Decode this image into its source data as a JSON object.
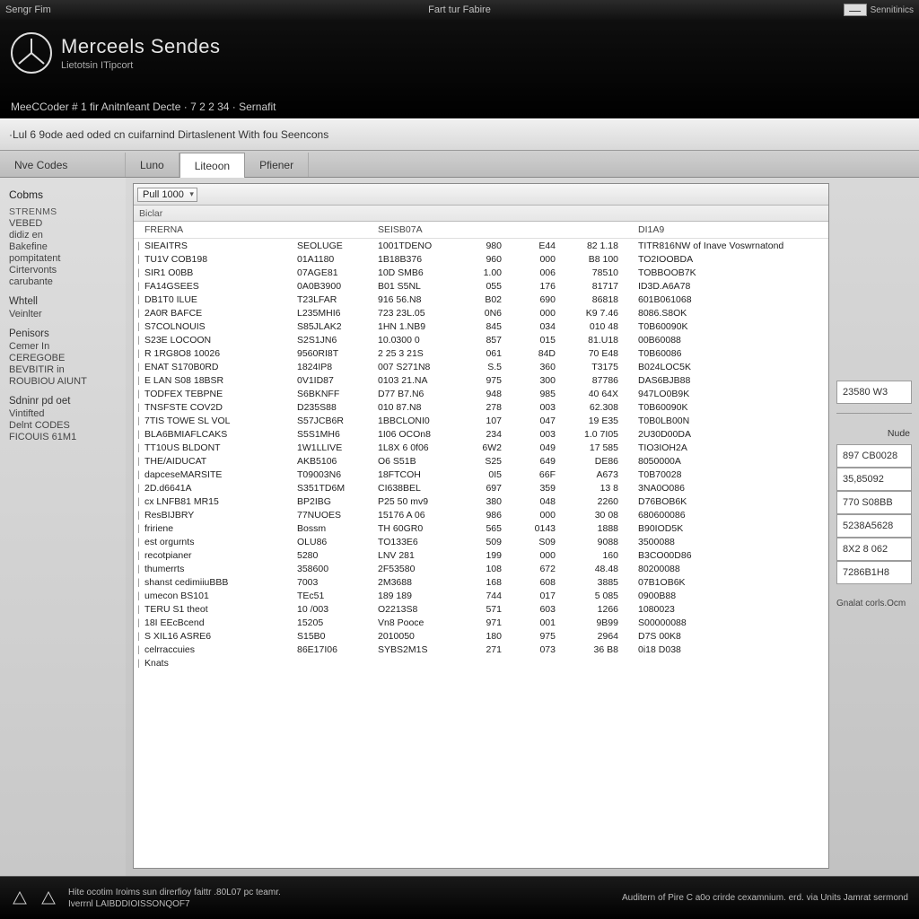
{
  "window": {
    "left_label": "Sengr Fim",
    "center_label": "Fart tur Fabire",
    "settings_label": "Sennitinics"
  },
  "brand": {
    "title": "Merceels Sendes",
    "subtitle": "Lietotsin ITipcort",
    "breadcrumb": "MeeCCoder # 1 fir Anitnfeant Decte · 7 2 2 34 · Sernafit"
  },
  "sub_header": "Lul 6 9ode aed oded cn cuifarnind Dirtaslenent With fou Seencons",
  "tabs": [
    {
      "label": "Nve Codes",
      "active": false
    },
    {
      "label": "Luno",
      "active": false
    },
    {
      "label": "Liteoon",
      "active": true
    },
    {
      "label": "Pfiener",
      "active": false
    }
  ],
  "sidebar": {
    "heading": "Cobms",
    "groups": [
      {
        "label": "STRENMS",
        "items": [
          "VEBED",
          "didiz en",
          "Bakefine",
          "pompitatent",
          "Cirtervonts",
          "carubante"
        ]
      },
      {
        "label": "Whtell",
        "items": [
          "Veinlter"
        ]
      },
      {
        "label": "Penisors",
        "items": [
          "Cemer In",
          "CEREGOBE",
          "BEVBITIR in",
          "ROUBIOU AIUNT"
        ]
      },
      {
        "label": "Sdninr pd oet",
        "items": [
          "Vintifted",
          "Delnt CODES",
          "FICOUIS 61M1"
        ]
      }
    ]
  },
  "toolbar": {
    "combo_label": "Pull 1000",
    "filter_label": "Biclar"
  },
  "columns": [
    "FRERNA",
    "",
    "SEISB07A",
    "",
    "",
    "",
    "DI1A9"
  ],
  "rows": [
    [
      "SIEAITRS",
      "SEOLUGE",
      "1001TDENO",
      "980",
      "E44",
      "82 1.18",
      "TITR816NW of Inave  Voswrnatond"
    ],
    [
      "TU1V COB198",
      "01A1180",
      "1B18B376",
      "960",
      "000",
      "B8 100",
      "TO2IOOBDA"
    ],
    [
      "SIR1 O0BB",
      "07AGE81",
      "10D SMB6",
      "1.00",
      "006",
      "78510",
      "TOBBOOB7K"
    ],
    [
      "FA14GSEES",
      "0A0B3900",
      "B01 S5NL",
      "055",
      "176",
      "81717",
      "ID3D.A6A78"
    ],
    [
      "DB1T0 ILUE",
      "T23LFAR",
      "916 56.N8",
      "B02",
      "690",
      "86818",
      "601B061068"
    ],
    [
      "2A0R BAFCE",
      "L235MHI6",
      "723 23L.05",
      "0N6",
      "000",
      "K9 7.46",
      "8086.S8OK"
    ],
    [
      "S7COLNOUIS",
      "S85JLAK2",
      "1HN 1.NB9",
      "845",
      "034",
      "010 48",
      "T0B60090K"
    ],
    [
      "S23E LOCOON",
      "S2S1JN6",
      "10.0300 0",
      "857",
      "015",
      "81.U18",
      "00B60088"
    ],
    [
      "R 1RG8O8 10026",
      "9560RI8T",
      "2 25 3 21S",
      "061",
      "84D",
      "70 E48",
      "T0B60086"
    ],
    [
      "ENAT S170B0RD",
      "1824IP8",
      "007 S271N8",
      "S.5",
      "360",
      "T3175",
      "B024LOC5K"
    ],
    [
      "E LAN S08 18BSR",
      "0V1ID87",
      "0103 21.NA",
      "975",
      "300",
      "87786",
      "DAS6BJB88"
    ],
    [
      "TODFEX TEBPNE",
      "S6BKNFF",
      "D77 B7.N6",
      "948",
      "985",
      "40 64X",
      "947LO0B9K"
    ],
    [
      "TNSFSTE COV2D",
      "D235S88",
      "010 87.N8",
      "278",
      "003",
      "62.308",
      "T0B60090K"
    ],
    [
      "7TIS TOWE SL VOL",
      "S57JCB6R",
      "1BBCLONI0",
      "107",
      "047",
      "19 E35",
      "T0B0LB00N"
    ],
    [
      "BLA6BMIAFLCAKS",
      "S5S1MH6",
      "1I06 OCOn8",
      "234",
      "003",
      "1.0 7I05",
      "2U30D00DA"
    ],
    [
      "TT10US BLDONT",
      "1W1LLIVE",
      "1L8X 6 0f06",
      "6W2",
      "049",
      "17 585",
      "TIO3IOH2A"
    ],
    [
      "THE/AIDUCAT",
      "AKB5106",
      "O6 S51B",
      "S25",
      "649",
      "DE86",
      "8050000A"
    ],
    [
      "dapceseMARSITE",
      "T09003N6",
      "18FTCOH",
      "0I5",
      "66F",
      "A673",
      "T0B70028"
    ],
    [
      "2D.d6641A",
      "S351TD6M",
      "CI638BEL",
      "697",
      "359",
      "13 8",
      "3NA0O086"
    ],
    [
      "cx LNFB81 MR15",
      "BP2IBG",
      "P25 50 mv9",
      "380",
      "048",
      "2260",
      "D76BOB6K"
    ],
    [
      "ResBIJBRY",
      "77NUOES",
      "15176 A 06",
      "986",
      "000",
      "30 08",
      "680600086"
    ],
    [
      "fririene",
      "Bossm",
      "TH 60GR0",
      "565",
      "0143",
      "1888",
      "B90IOD5K"
    ],
    [
      "est orgurnts",
      "OLU86",
      "TO133E6",
      "509",
      "S09",
      "9088",
      "3500088"
    ],
    [
      "recotpianer",
      "5280",
      "LNV 281",
      "199",
      "000",
      "160",
      "B3CO00D86"
    ],
    [
      "thumerrts",
      "358600",
      "2F53580",
      "108",
      "672",
      "48.48",
      "80200088"
    ],
    [
      "shanst cedimiiuBBB",
      "7003",
      "2M3688",
      "168",
      "608",
      "3885",
      "07B1OB6K"
    ],
    [
      "umecon BS101",
      "TEc51",
      "189 189",
      "744",
      "017",
      "5 085",
      "0900B88"
    ],
    [
      "TERU S1 theot",
      "10 /003",
      "O2213S8",
      "571",
      "603",
      "1266",
      "1080023"
    ],
    [
      "18I EEcBcend",
      "15205",
      "Vn8 Pooce",
      "971",
      "001",
      "9B99",
      "S00000088"
    ],
    [
      "S XIL16 ASRE6",
      "S15B0",
      "2010050",
      "180",
      "975",
      "2964",
      "D7S 00K8"
    ],
    [
      "celrraccuies",
      "86E17I06",
      "SYBS2M1S",
      "271",
      "073",
      "36 B8",
      "0i18 D038"
    ],
    [
      "Knats",
      "",
      "",
      "",
      "",
      "",
      ""
    ]
  ],
  "detail": {
    "top_box": "23580 W3",
    "label_node": "Nude",
    "boxes": [
      "897 CB0028",
      "35,85092",
      "770  S08BB",
      "5238A5628",
      "8X2 8  062",
      "7286B1H8"
    ],
    "footer_text": "Gnalat corls.Ocm"
  },
  "footer": {
    "left_line1": "Hite ocotim Iroims sun direrfioy faittr .80L07 pc teamr.",
    "left_line2": "Iverrnl LAIBDDIOISSONQOF7",
    "right": "Auditern of Pire C a0o crirde cexamnium. erd. via Units Jamrat sermond"
  }
}
